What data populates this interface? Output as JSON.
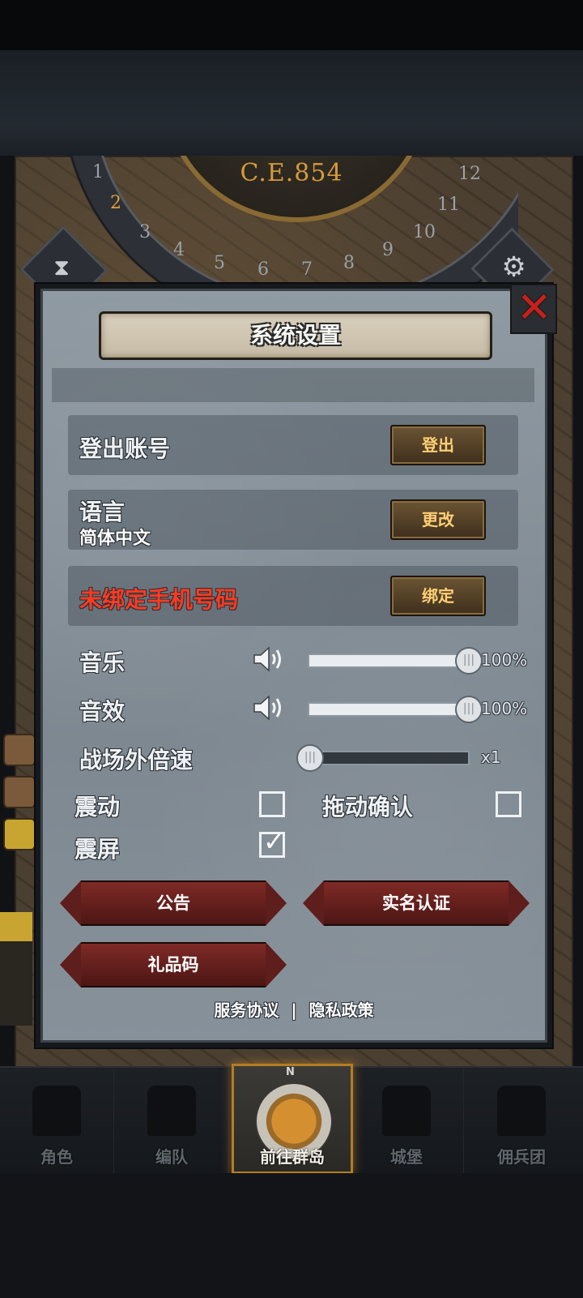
{
  "background": {
    "era_label": "C.E.854",
    "dial_numbers": [
      "1",
      "2",
      "3",
      "4",
      "5",
      "6",
      "7",
      "8",
      "9",
      "10",
      "11",
      "12"
    ],
    "active_dial_number": "2"
  },
  "dialog": {
    "title": "系统设置",
    "close_label": "✕",
    "account_row": {
      "label": "登出账号",
      "button": "登出"
    },
    "language_row": {
      "label": "语言",
      "value": "简体中文",
      "button": "更改"
    },
    "phone_row": {
      "label": "未绑定手机号码",
      "button": "绑定"
    },
    "music": {
      "label": "音乐",
      "value_text": "100%",
      "level": 1.0
    },
    "sfx": {
      "label": "音效",
      "value_text": "100%",
      "level": 1.0
    },
    "speed": {
      "label": "战场外倍速",
      "value_text": "x1",
      "level": 0.0
    },
    "vibration": {
      "label": "震动",
      "checked": false
    },
    "drag_confirm": {
      "label": "拖动确认",
      "checked": false
    },
    "screen_shake": {
      "label": "震屏",
      "checked": true
    },
    "buttons": {
      "announcement": "公告",
      "real_name": "实名认证",
      "gift_code": "礼品码"
    },
    "links": {
      "service": "服务协议",
      "separator": "|",
      "privacy": "隐私政策"
    }
  },
  "navbar": {
    "items": [
      {
        "label": "角色",
        "icon": "knight-icon"
      },
      {
        "label": "编队",
        "icon": "helmet-icon"
      },
      {
        "label": "前往群岛",
        "icon": "compass-icon",
        "active": true
      },
      {
        "label": "城堡",
        "icon": "castle-icon"
      },
      {
        "label": "佣兵团",
        "icon": "mercenary-icon"
      }
    ],
    "compass_north": "N"
  },
  "colors": {
    "accent_gold": "#d69a3a",
    "warning_red": "#ff3b22",
    "close_red": "#c8201a",
    "button_text_gold": "#ffcf74"
  }
}
